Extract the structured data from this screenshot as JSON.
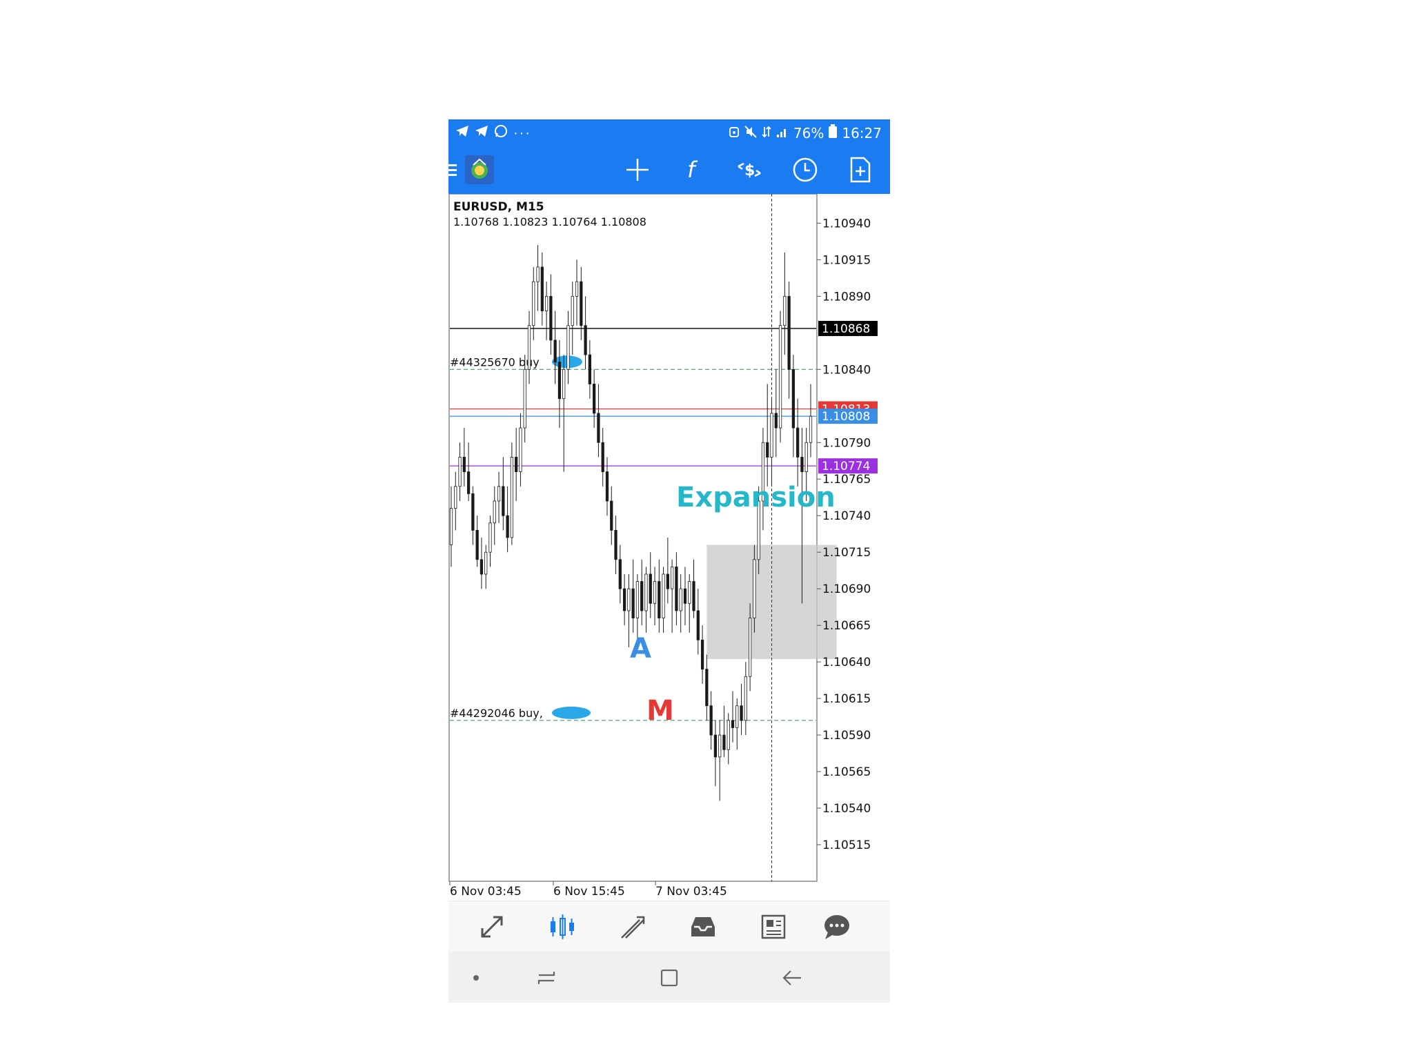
{
  "status_bar": {
    "icons_left": [
      "telegram-icon",
      "telegram-icon",
      "whatsapp-icon",
      "more-dots-icon"
    ],
    "battery": "76%",
    "time": "16:27",
    "icons_right": [
      "alarm-icon",
      "mute-icon",
      "data-icon",
      "signal-icon",
      "battery-icon"
    ]
  },
  "toolbar": {
    "buttons": [
      "menu-icon",
      "app-logo-icon",
      "crosshair-icon",
      "function-icon",
      "dollar-arrows-icon",
      "clock-icon",
      "new-order-icon"
    ]
  },
  "chart_header": {
    "symbol": "EURUSD, M15",
    "ohlc": "1.10768 1.10823 1.10764 1.10808"
  },
  "price_axis": {
    "ticks": [
      "1.10940",
      "1.10915",
      "1.10890",
      "1.10840",
      "1.10790",
      "1.10765",
      "1.10740",
      "1.10715",
      "1.10690",
      "1.10665",
      "1.10640",
      "1.10615",
      "1.10590",
      "1.10565",
      "1.10540",
      "1.10515"
    ],
    "labels": [
      {
        "text": "1.10868",
        "color": "#000000"
      },
      {
        "text": "1.10813",
        "color": "#e53935"
      },
      {
        "text": "1.10808",
        "color": "#3a8ee6"
      },
      {
        "text": "1.10774",
        "color": "#9b30e0"
      }
    ]
  },
  "time_axis": {
    "ticks": [
      "6 Nov 03:45",
      "6 Nov 15:45",
      "7 Nov 03:45"
    ]
  },
  "orders": [
    {
      "text": "#44325670 buy",
      "price": 1.1084
    },
    {
      "text": "#44292046 buy,",
      "price": 1.106
    }
  ],
  "annotations": {
    "expansion": "Expansion",
    "a": "A",
    "m": "M",
    "expansion_color": "#26b8c8",
    "a_color": "#3a8ee6",
    "m_color": "#e53935"
  },
  "bottom_nav": {
    "items": [
      "quotes-icon",
      "chart-icon",
      "trade-icon",
      "history-icon",
      "news-icon",
      "chat-icon"
    ],
    "active": "chart-icon"
  },
  "chart_data": {
    "type": "candlestick",
    "title": "EURUSD, M15",
    "ylim": [
      1.1049,
      1.1096
    ],
    "lines": [
      {
        "price": 1.10868,
        "color": "#000000"
      },
      {
        "price": 1.10813,
        "color": "#e53935"
      },
      {
        "price": 1.10808,
        "color": "#3a8ee6"
      },
      {
        "price": 1.10774,
        "color": "#9b30e0"
      }
    ],
    "range_box": {
      "from_index": 59,
      "to_index": 89,
      "high": 1.1072,
      "low": 1.10642
    },
    "crosshair_index": 74,
    "points": [
      [
        1.1072,
        1.1076,
        1.10705,
        1.10745
      ],
      [
        1.10745,
        1.1077,
        1.1073,
        1.1076
      ],
      [
        1.1076,
        1.1079,
        1.1075,
        1.1078
      ],
      [
        1.1078,
        1.108,
        1.1076,
        1.1077
      ],
      [
        1.1077,
        1.1079,
        1.1075,
        1.10755
      ],
      [
        1.10755,
        1.1076,
        1.1072,
        1.1073
      ],
      [
        1.1073,
        1.1074,
        1.10705,
        1.1071
      ],
      [
        1.1071,
        1.10725,
        1.1069,
        1.107
      ],
      [
        1.107,
        1.1072,
        1.1069,
        1.10715
      ],
      [
        1.10715,
        1.1074,
        1.10705,
        1.10735
      ],
      [
        1.10735,
        1.1076,
        1.1072,
        1.1075
      ],
      [
        1.1075,
        1.1077,
        1.10735,
        1.1076
      ],
      [
        1.1076,
        1.1078,
        1.1073,
        1.1074
      ],
      [
        1.1074,
        1.1076,
        1.10715,
        1.10725
      ],
      [
        1.10725,
        1.1079,
        1.1072,
        1.1078
      ],
      [
        1.1078,
        1.108,
        1.1075,
        1.1077
      ],
      [
        1.1077,
        1.1081,
        1.1076,
        1.108
      ],
      [
        1.108,
        1.1085,
        1.1079,
        1.1084
      ],
      [
        1.1084,
        1.1088,
        1.1083,
        1.1087
      ],
      [
        1.1087,
        1.1091,
        1.1086,
        1.109
      ],
      [
        1.109,
        1.10925,
        1.1088,
        1.1091
      ],
      [
        1.1091,
        1.1092,
        1.1087,
        1.1088
      ],
      [
        1.1088,
        1.109,
        1.1086,
        1.1089
      ],
      [
        1.1089,
        1.10905,
        1.1085,
        1.1086
      ],
      [
        1.1086,
        1.1088,
        1.1083,
        1.10845
      ],
      [
        1.10845,
        1.1086,
        1.108,
        1.1082
      ],
      [
        1.1082,
        1.1085,
        1.1077,
        1.1084
      ],
      [
        1.1084,
        1.1088,
        1.1083,
        1.1087
      ],
      [
        1.1087,
        1.109,
        1.1085,
        1.1089
      ],
      [
        1.1089,
        1.10915,
        1.1087,
        1.109
      ],
      [
        1.109,
        1.1091,
        1.1086,
        1.1087
      ],
      [
        1.1087,
        1.1089,
        1.1084,
        1.1085
      ],
      [
        1.1085,
        1.1086,
        1.1082,
        1.1083
      ],
      [
        1.1083,
        1.1084,
        1.108,
        1.1081
      ],
      [
        1.1081,
        1.1083,
        1.1078,
        1.1079
      ],
      [
        1.1079,
        1.108,
        1.1076,
        1.1077
      ],
      [
        1.1077,
        1.1078,
        1.1074,
        1.1075
      ],
      [
        1.1075,
        1.1076,
        1.1072,
        1.1073
      ],
      [
        1.1073,
        1.1074,
        1.107,
        1.1071
      ],
      [
        1.1071,
        1.1072,
        1.1068,
        1.1069
      ],
      [
        1.1069,
        1.107,
        1.10665,
        1.10675
      ],
      [
        1.10675,
        1.107,
        1.1065,
        1.1069
      ],
      [
        1.1069,
        1.1071,
        1.1066,
        1.1067
      ],
      [
        1.1067,
        1.107,
        1.10655,
        1.10695
      ],
      [
        1.10695,
        1.1071,
        1.10665,
        1.10675
      ],
      [
        1.10675,
        1.10705,
        1.1066,
        1.107
      ],
      [
        1.107,
        1.10715,
        1.1067,
        1.1068
      ],
      [
        1.1068,
        1.10705,
        1.10665,
        1.10695
      ],
      [
        1.10695,
        1.1071,
        1.1066,
        1.1067
      ],
      [
        1.1067,
        1.10705,
        1.1066,
        1.107
      ],
      [
        1.107,
        1.10725,
        1.1068,
        1.1069
      ],
      [
        1.1069,
        1.1071,
        1.1066,
        1.10705
      ],
      [
        1.10705,
        1.10715,
        1.10665,
        1.10675
      ],
      [
        1.10675,
        1.107,
        1.1066,
        1.1069
      ],
      [
        1.1069,
        1.10705,
        1.10665,
        1.1068
      ],
      [
        1.1068,
        1.107,
        1.1066,
        1.10695
      ],
      [
        1.10695,
        1.1071,
        1.1067,
        1.10675
      ],
      [
        1.10675,
        1.1069,
        1.10645,
        1.10655
      ],
      [
        1.10655,
        1.10665,
        1.10625,
        1.10635
      ],
      [
        1.10635,
        1.10645,
        1.106,
        1.1061
      ],
      [
        1.1061,
        1.1062,
        1.1058,
        1.1059
      ],
      [
        1.1059,
        1.106,
        1.10555,
        1.10575
      ],
      [
        1.10575,
        1.106,
        1.10545,
        1.1059
      ],
      [
        1.1059,
        1.1061,
        1.10575,
        1.1058
      ],
      [
        1.1058,
        1.10605,
        1.1057,
        1.106
      ],
      [
        1.106,
        1.1062,
        1.10585,
        1.10595
      ],
      [
        1.10595,
        1.10615,
        1.1058,
        1.1061
      ],
      [
        1.1061,
        1.10625,
        1.1059,
        1.106
      ],
      [
        1.106,
        1.1064,
        1.1059,
        1.1063
      ],
      [
        1.1063,
        1.1068,
        1.1062,
        1.1067
      ],
      [
        1.1067,
        1.1072,
        1.1066,
        1.1071
      ],
      [
        1.1071,
        1.1076,
        1.107,
        1.1075
      ],
      [
        1.1075,
        1.108,
        1.1073,
        1.1079
      ],
      [
        1.1079,
        1.1083,
        1.1076,
        1.1078
      ],
      [
        1.1078,
        1.1082,
        1.1076,
        1.1081
      ],
      [
        1.1081,
        1.1084,
        1.1078,
        1.108
      ],
      [
        1.108,
        1.1088,
        1.1079,
        1.1087
      ],
      [
        1.1087,
        1.1092,
        1.1085,
        1.1089
      ],
      [
        1.1089,
        1.109,
        1.1082,
        1.1084
      ],
      [
        1.1084,
        1.1085,
        1.1078,
        1.108
      ],
      [
        1.108,
        1.1082,
        1.1076,
        1.1078
      ],
      [
        1.1078,
        1.108,
        1.1068,
        1.1077
      ],
      [
        1.1077,
        1.108,
        1.1075,
        1.1079
      ],
      [
        1.1079,
        1.1083,
        1.1078,
        1.10808
      ]
    ]
  }
}
